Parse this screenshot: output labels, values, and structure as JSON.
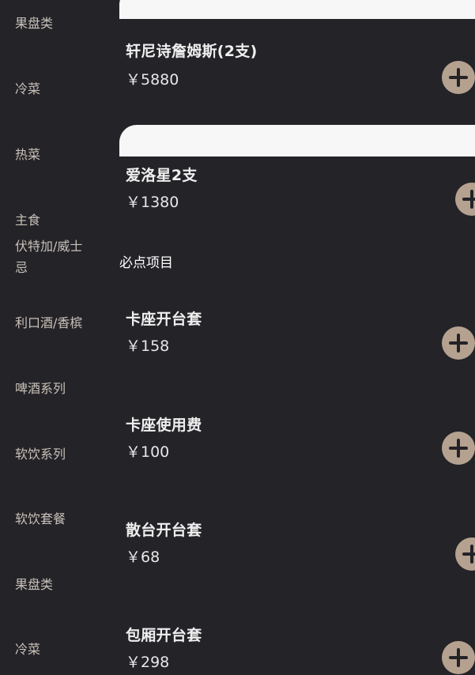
{
  "sidebar": {
    "categories": [
      {
        "label": "果盘类"
      },
      {
        "label": "冷菜"
      },
      {
        "label": "热菜"
      },
      {
        "label": "主食"
      },
      {
        "label": "伏特加/威士忌"
      },
      {
        "label": "利口酒/香槟"
      },
      {
        "label": "啤酒系列"
      },
      {
        "label": "软饮系列"
      },
      {
        "label": "软饮套餐"
      },
      {
        "label": "果盘类"
      },
      {
        "label": "冷菜"
      }
    ]
  },
  "products": [
    {
      "name": "轩尼诗詹姆斯(2支)",
      "price": "￥5880"
    },
    {
      "name": "爱洛星2支",
      "price": "￥1380"
    }
  ],
  "required_section": {
    "title": "必点项目",
    "items": [
      {
        "name": "卡座开台套",
        "price": "￥158"
      },
      {
        "name": "卡座使用费",
        "price": "￥100"
      },
      {
        "name": "散台开台套",
        "price": "￥68"
      },
      {
        "name": "包厢开台套",
        "price": "￥298"
      }
    ]
  },
  "colors": {
    "background": "#232328",
    "accent_button": "#b5a18f",
    "category_text": "#c9c1b8"
  },
  "icons": {
    "add": "plus-icon"
  }
}
